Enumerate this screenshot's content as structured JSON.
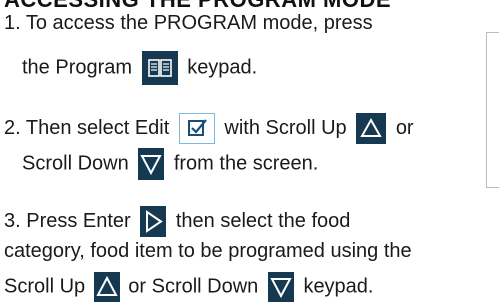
{
  "heading_partial": "ACCESSING THE PROGRAM MODE",
  "steps": {
    "s1": {
      "line1": "1. To access the PROGRAM mode, press",
      "pre": "the Program",
      "post": "keypad."
    },
    "s2": {
      "pre": "2.  Then select Edit",
      "mid": "with Scroll Up",
      "post": "or",
      "line2_pre": "Scroll Down",
      "line2_post": "from the screen."
    },
    "s3": {
      "pre": "3.  Press Enter",
      "post": "then select the food",
      "line2": "category, food item to be programed using the",
      "line3_pre": "Scroll Up",
      "line3_mid": "or Scroll Down",
      "line3_post": "keypad."
    }
  },
  "icons": {
    "program": "book-icon",
    "edit": "edit-checkbox-icon",
    "scroll_up": "triangle-up-icon",
    "scroll_down": "triangle-down-icon",
    "enter": "play-right-icon"
  },
  "colors": {
    "key_dark": "#143950",
    "icon_light": "#ffffff",
    "edit_border": "#7fb8df",
    "edit_icon": "#1a4e78"
  }
}
